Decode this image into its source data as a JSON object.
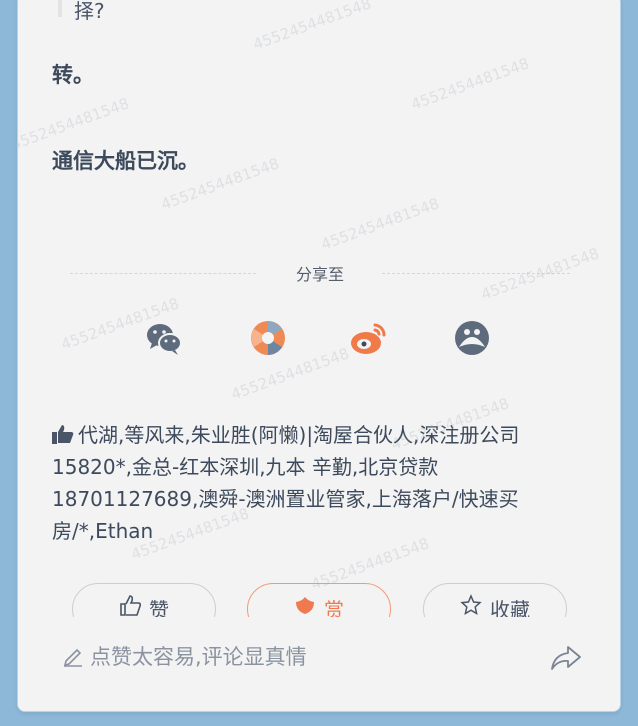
{
  "article": {
    "quote_fragment": "择?",
    "para1": "转。",
    "para2": "通信大船已沉。"
  },
  "share": {
    "label": "分享至",
    "icons": [
      "wechat-icon",
      "moments-icon",
      "weibo-icon",
      "qq-icon"
    ]
  },
  "likes": {
    "text": "代湖,等风来,朱业胜(阿懒)|淘屋合伙人,深注册公司15820*,金总-红本深圳,九本 辛勤,北京贷款18701127689,澳舜-澳洲置业管家,上海落户/快速买房/*,Ethan"
  },
  "actions": {
    "like_label": "赞",
    "reward_label": "赏",
    "collect_label": "收藏"
  },
  "comment": {
    "placeholder": "点赞太容易,评论显真情"
  },
  "watermark": "4552454481548",
  "colors": {
    "accent": "#ee7a50",
    "text": "#3d4a5c",
    "background": "#f3f3f3"
  }
}
